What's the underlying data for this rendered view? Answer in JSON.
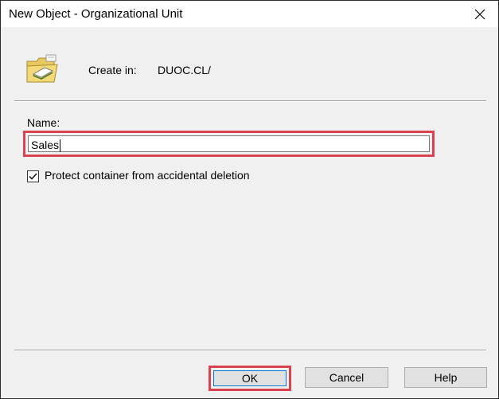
{
  "window": {
    "title": "New Object - Organizational Unit",
    "close_icon": "close-icon"
  },
  "header": {
    "icon": "organizational-unit-icon",
    "create_in_label": "Create in:",
    "create_in_value": "DUOC.CL/"
  },
  "form": {
    "name_label": "Name:",
    "name_value": "Sales",
    "protect_label": "Protect container from accidental deletion",
    "protect_checked": true
  },
  "buttons": {
    "ok": "OK",
    "cancel": "Cancel",
    "help": "Help"
  },
  "colors": {
    "highlight": "#d9434f",
    "dialog_bg": "#f0f0f0",
    "button_bg": "#e1e1e1"
  }
}
